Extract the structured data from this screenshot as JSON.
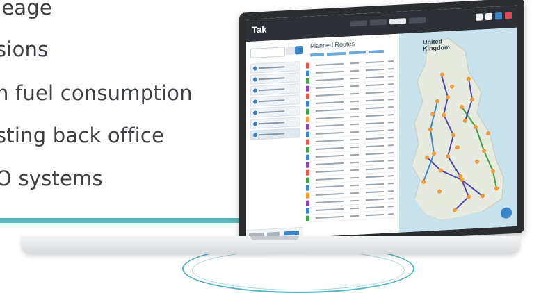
{
  "bullets": [
    "leage",
    "sions",
    "n fuel consumption",
    "sting back office",
    "O systems"
  ],
  "map": {
    "label_line1": "United",
    "label_line2": "Kingdom"
  },
  "app": {
    "title": "Planned Routes"
  },
  "colors": {
    "accent": "#5bbdbf",
    "ring": "#4eb4c3",
    "route_marker": "#f29a3a",
    "route_line": "#4a4aa8"
  }
}
